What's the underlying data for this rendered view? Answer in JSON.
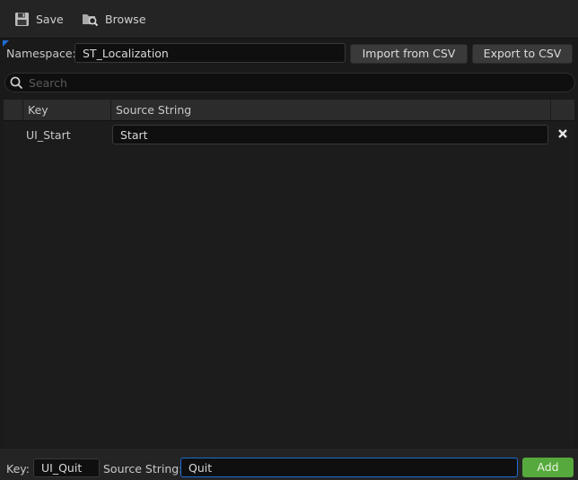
{
  "toolbar": {
    "save_label": "Save",
    "browse_label": "Browse"
  },
  "namespace": {
    "label": "Namespace:",
    "value": "ST_Localization",
    "import_label": "Import from CSV",
    "export_label": "Export to CSV"
  },
  "search": {
    "placeholder": "Search"
  },
  "table": {
    "columns": [
      "Key",
      "Source String"
    ],
    "rows": [
      {
        "key": "UI_Start",
        "source": "Start"
      }
    ]
  },
  "add_bar": {
    "key_label": "Key:",
    "key_value": "UI_Quit",
    "source_label": "Source String:",
    "source_value": "Quit",
    "add_label": "Add"
  },
  "colors": {
    "accent": "#1e6cd6",
    "add_button": "#56a93c",
    "background": "#1a1a1a"
  },
  "icons": {
    "save": "save-disk-icon",
    "browse": "browse-folder-magnifier-icon",
    "search": "search-icon",
    "delete": "close-x-icon"
  }
}
